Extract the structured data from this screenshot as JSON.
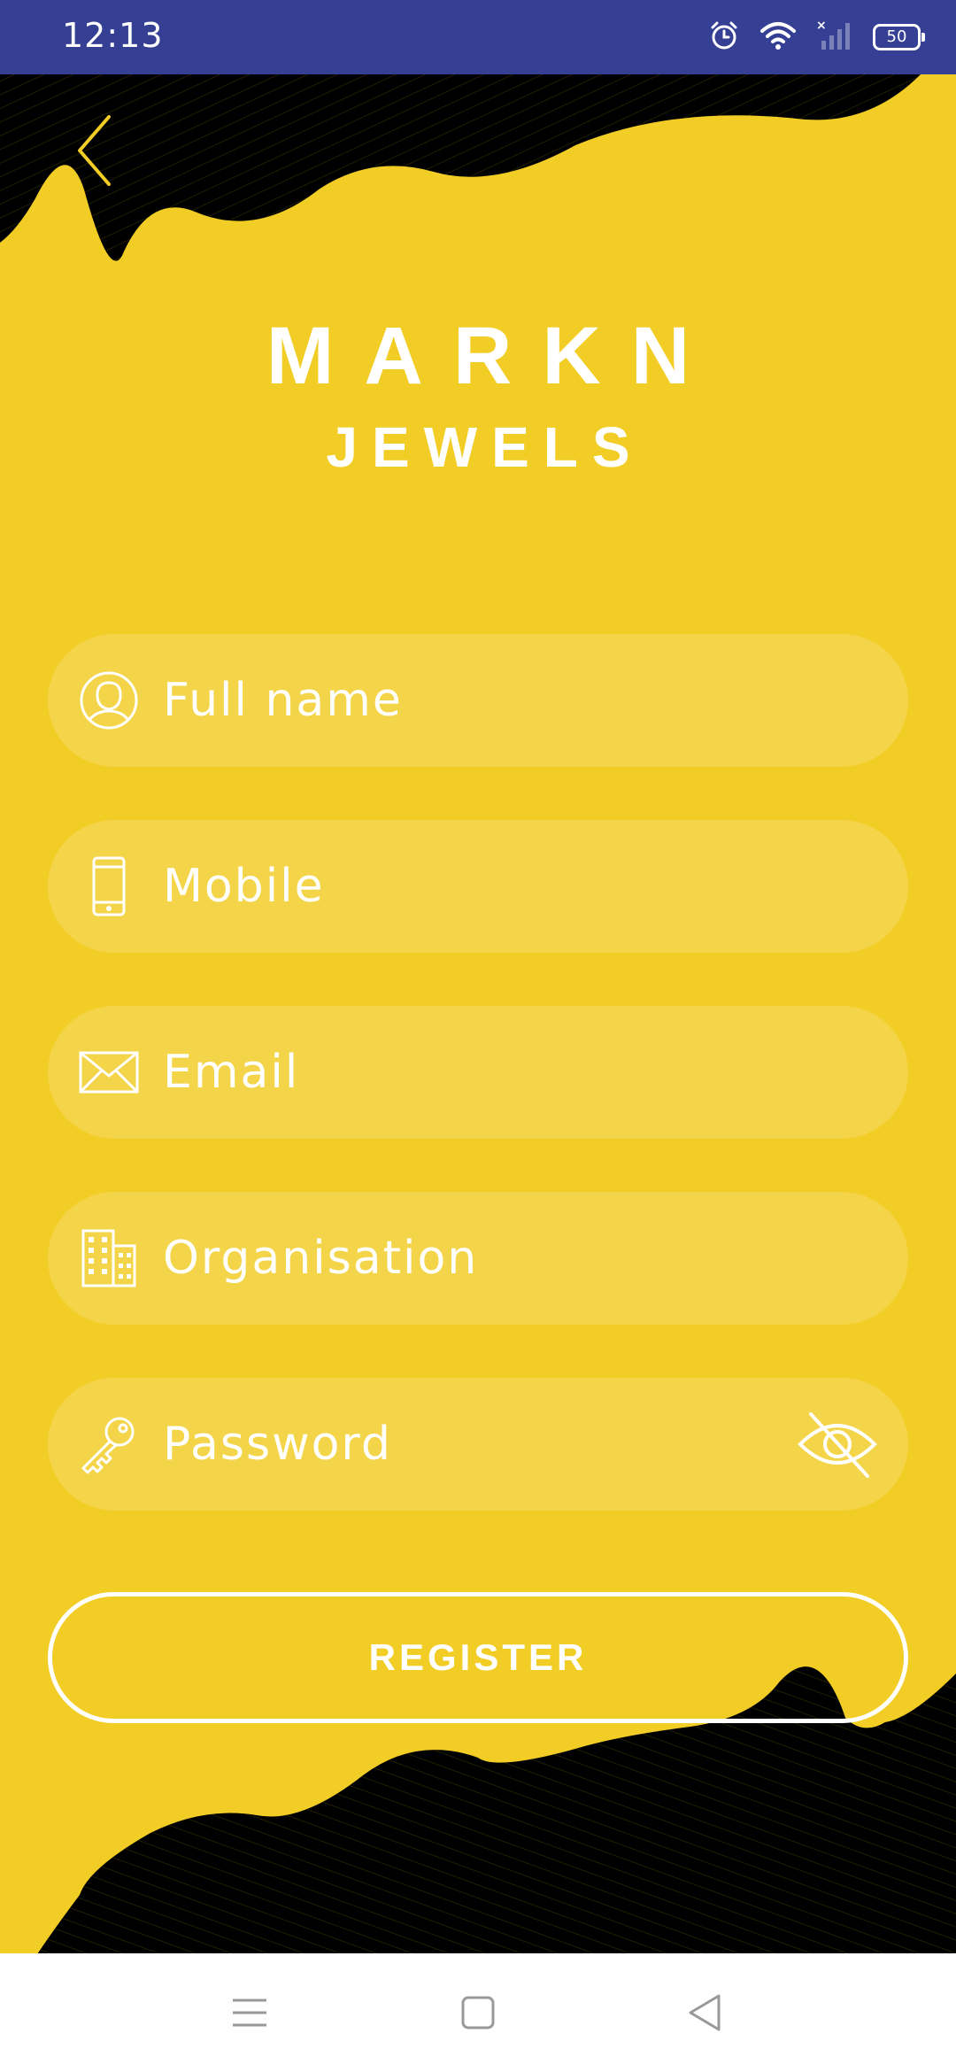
{
  "status_bar": {
    "time": "12:13",
    "battery": "50",
    "icons": [
      "alarm-icon",
      "wifi-icon",
      "signal-icon",
      "battery-icon"
    ]
  },
  "brand": {
    "title": "MARKN",
    "subtitle": "JEWELS"
  },
  "form": {
    "fields": [
      {
        "icon": "user-icon",
        "placeholder": "Full name",
        "value": ""
      },
      {
        "icon": "mobile-phone-icon",
        "placeholder": "Mobile",
        "value": ""
      },
      {
        "icon": "envelope-icon",
        "placeholder": "Email",
        "value": ""
      },
      {
        "icon": "building-icon",
        "placeholder": "Organisation",
        "value": ""
      },
      {
        "icon": "key-icon",
        "placeholder": "Password",
        "value": ""
      }
    ],
    "register_label": "REGISTER"
  },
  "colors": {
    "background": "#F2CD25",
    "status_bar": "#353F93",
    "wave": "#000000",
    "text": "#FFFFFF"
  },
  "nav_bar": {
    "icons": [
      "menu-icon",
      "home-square-icon",
      "back-triangle-icon"
    ]
  }
}
